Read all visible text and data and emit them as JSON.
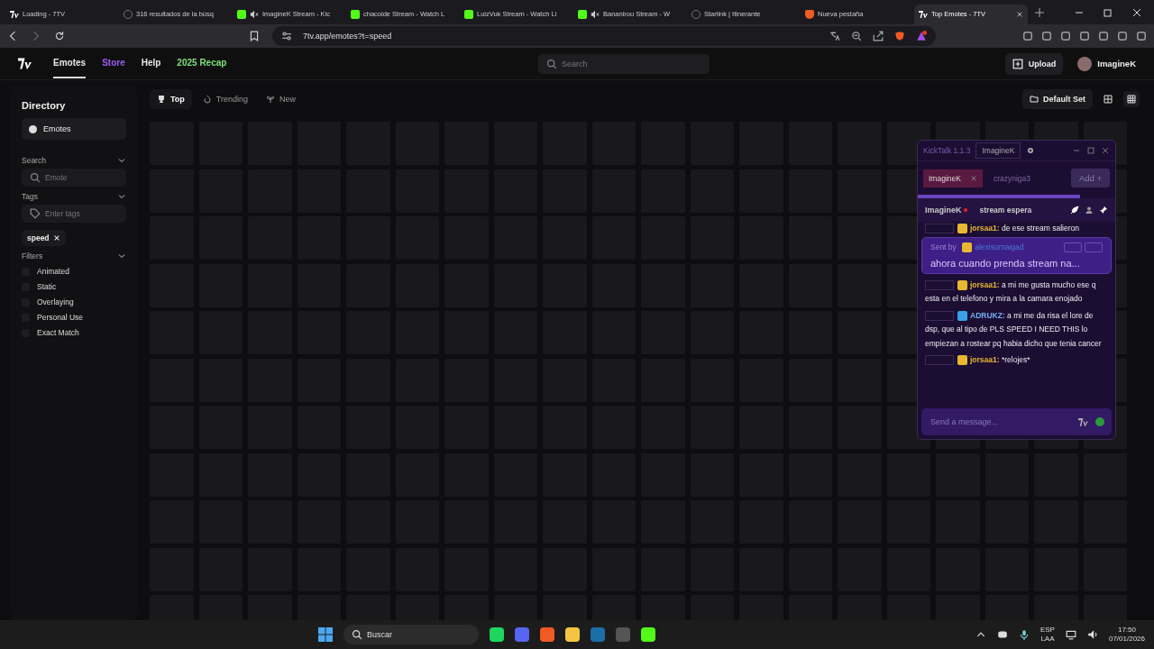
{
  "browser": {
    "tabs": [
      {
        "title": "Loading - 7TV",
        "kind": "sevtv",
        "muted": false,
        "selected": false
      },
      {
        "title": "316 resultados de la búsq",
        "kind": "generic",
        "muted": false,
        "selected": false
      },
      {
        "title": "ImagineK Stream - Kic",
        "kind": "kick",
        "muted": true,
        "selected": false
      },
      {
        "title": "chacoide Stream - Watch L",
        "kind": "kick",
        "muted": false,
        "selected": false
      },
      {
        "title": "LuizVuk Stream - Watch Li",
        "kind": "kick",
        "muted": false,
        "selected": false
      },
      {
        "title": "Bananirou Stream - W",
        "kind": "kick",
        "muted": true,
        "selected": false
      },
      {
        "title": "Starlink | Itinerante",
        "kind": "generic",
        "muted": false,
        "selected": false
      },
      {
        "title": "Nueva pestaña",
        "kind": "brave",
        "muted": false,
        "selected": false
      },
      {
        "title": "Top Emotes - 7TV",
        "kind": "sevtv",
        "muted": false,
        "selected": true
      }
    ],
    "url": "7tv.app/emotes?t=speed"
  },
  "header": {
    "nav": [
      {
        "label": "Emotes",
        "kind": "plain",
        "selected": true
      },
      {
        "label": "Store",
        "kind": "store",
        "selected": false
      },
      {
        "label": "Help",
        "kind": "plain",
        "selected": false
      },
      {
        "label": "2025 Recap",
        "kind": "recap",
        "selected": false
      }
    ],
    "search_placeholder": "Search",
    "upload": "Upload",
    "user": "ImagineK"
  },
  "sidebar": {
    "title": "Directory",
    "item": "Emotes",
    "search_label": "Search",
    "search_placeholder": "Emote",
    "tags_label": "Tags",
    "tags_placeholder": "Enter tags",
    "tag": "speed",
    "filters_label": "Filters",
    "filters": [
      {
        "label": "Animated",
        "checked": false
      },
      {
        "label": "Static",
        "checked": false
      },
      {
        "label": "Overlaying",
        "checked": false
      },
      {
        "label": "Personal Use",
        "checked": false
      },
      {
        "label": "Exact Match",
        "checked": false
      }
    ]
  },
  "sort_tabs": [
    {
      "label": "Top",
      "selected": true
    },
    {
      "label": "Trending",
      "selected": false
    },
    {
      "label": "New",
      "selected": false
    }
  ],
  "default_set": "Default Set",
  "kicktalk": {
    "title": "KickTalk 1.1.3",
    "account": "ImagineK",
    "chats": [
      {
        "label": "ImagineK",
        "selected": true
      },
      {
        "label": "crazyniga3",
        "selected": false
      }
    ],
    "add": "Add +",
    "loading": {
      "level": 0.82
    },
    "channel": "ImagineK",
    "stream_title": "stream espera",
    "pinned": {
      "label": "Sent by",
      "user": "alexisomaigad",
      "text": "ahora cuando prenda stream na..."
    },
    "messages": [
      {
        "user": "jorsaa1:",
        "kind": "crown",
        "text": "de ese stream salieron"
      },
      {
        "user": "jorsaa1:",
        "kind": "crown",
        "text": "a mi me gusta mucho ese q esta en el telefono y mira a la camara enojado"
      },
      {
        "user": "ADRUKZ:",
        "kind": "hammer",
        "text": "a mi me da risa el lore de dsp, que al tipo de PLS SPEED I NEED THIS lo empiezan a rostear pq habia dicho que tenia cancer"
      },
      {
        "user": "jorsaa1:",
        "kind": "crown",
        "text": "*relojes*"
      }
    ],
    "input_placeholder": "Send a message..."
  },
  "taskbar": {
    "search_placeholder": "Buscar",
    "lang_top": "ESP",
    "lang_bottom": "LAA",
    "time": "17:50",
    "date": "07/01/2026"
  }
}
